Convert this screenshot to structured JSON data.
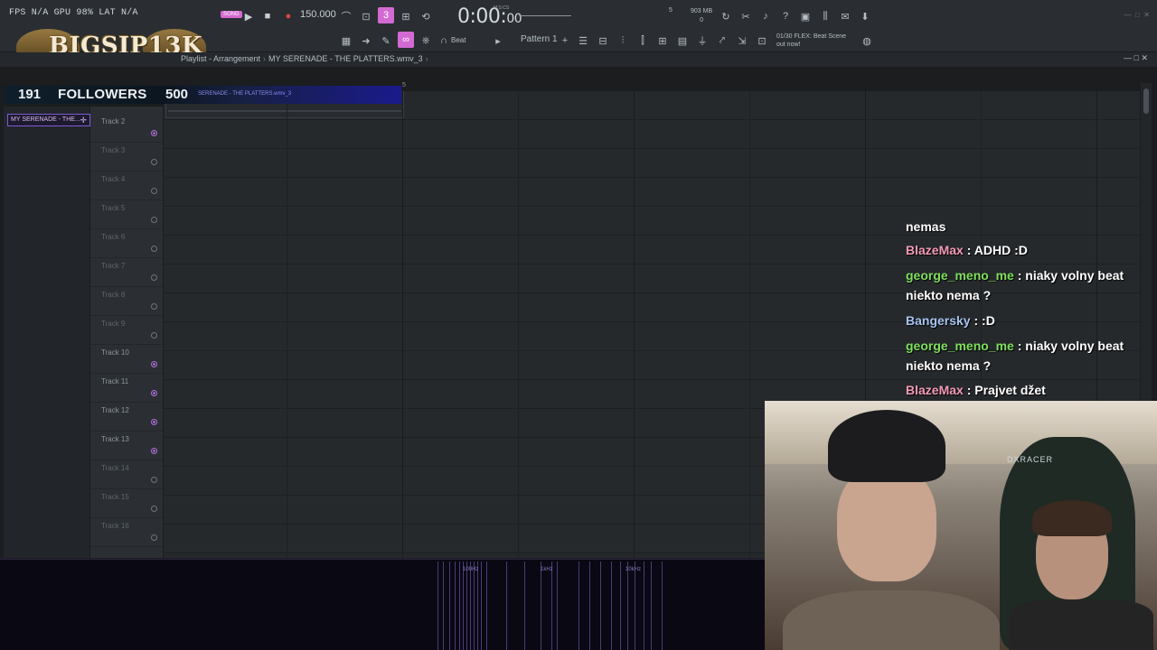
{
  "toolbar": {
    "perf_text": "FPS N/A  GPU 98%  LAT N/A",
    "tempo": "150.000",
    "time_main": "0:00:",
    "time_small": "00",
    "time_unit": "M:S:CS",
    "cpu": "5",
    "memory_mb": "903 MB",
    "memory_sub": "0",
    "pattern": "Pattern 1",
    "snap": "Beat",
    "news_line1": "01/30  FLEX: Beat Scene",
    "news_line2": "out now!",
    "song_badge": "SONG"
  },
  "logo": {
    "text": "BIGSIP13K"
  },
  "playlist": {
    "crumb1": "Playlist - Arrangement",
    "crumb2": "MY SERENADE - THE PLATTERS.wmv_3",
    "ruler_num": "5",
    "clip_label": "SERENADE - THE PLATTERS.wmv_3",
    "left_item": "MY SERENADE - THE..."
  },
  "followers": {
    "count": "191",
    "label": "FOLLOWERS",
    "goal": "500"
  },
  "tracks": [
    {
      "name": "Track 2",
      "active": true
    },
    {
      "name": "Track 3",
      "active": false
    },
    {
      "name": "Track 4",
      "active": false
    },
    {
      "name": "Track 5",
      "active": false
    },
    {
      "name": "Track 6",
      "active": false
    },
    {
      "name": "Track 7",
      "active": false
    },
    {
      "name": "Track 8",
      "active": false
    },
    {
      "name": "Track 9",
      "active": false
    },
    {
      "name": "Track 10",
      "active": true
    },
    {
      "name": "Track 11",
      "active": true
    },
    {
      "name": "Track 12",
      "active": true
    },
    {
      "name": "Track 13",
      "active": true
    },
    {
      "name": "Track 14",
      "active": false
    },
    {
      "name": "Track 15",
      "active": false
    },
    {
      "name": "Track 16",
      "active": false
    }
  ],
  "spectrum": {
    "labels": [
      "100Hz",
      "1kHz",
      "10kHz"
    ]
  },
  "chat": {
    "messages": [
      {
        "user": "",
        "text": "nemas",
        "color": "#ffffff"
      },
      {
        "user": "BlazeMax",
        "text": " : ADHD :D",
        "color": "#f39ab6"
      },
      {
        "user": "george_meno_me",
        "text": " : niaky volny beat niekto nema ?",
        "color": "#7fe05c"
      },
      {
        "user": "Bangersky",
        "text": " : :D",
        "color": "#a6c4f0"
      },
      {
        "user": "george_meno_me",
        "text": " : niaky volny beat niekto nema ?",
        "color": "#7fe05c"
      },
      {
        "user": "BlazeMax",
        "text": " : Prajvet džet",
        "color": "#f39ab6"
      }
    ]
  },
  "webcam": {
    "chair_brand": "DXRACER"
  }
}
